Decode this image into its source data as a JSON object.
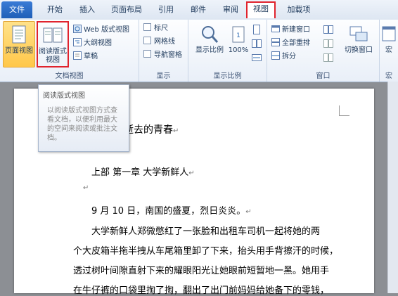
{
  "tabs": [
    "文件",
    "开始",
    "插入",
    "页面布局",
    "引用",
    "邮件",
    "审阅",
    "视图",
    "加载项"
  ],
  "active_tab": "视图",
  "ribbon": {
    "doc_views": {
      "label": "文档视图",
      "page_view": "页面视图",
      "reading_view_1": "阅读版式",
      "reading_view_2": "视图",
      "web_view": "Web 版式视图",
      "outline": "大纲视图",
      "draft": "草稿"
    },
    "show": {
      "label": "显示",
      "ruler": "标尺",
      "gridlines": "网格线",
      "nav_pane": "导航窗格"
    },
    "zoom": {
      "label": "显示比例",
      "zoom": "显示比例",
      "hundred": "100%"
    },
    "window": {
      "label": "窗口",
      "new_window": "新建窗口",
      "arrange_all": "全部重排",
      "split": "拆分",
      "switch_windows": "切换窗口"
    },
    "macros": {
      "label": "宏",
      "macros": "宏"
    }
  },
  "tooltip": {
    "title": "阅读版式视图",
    "lines": [
      "以阅读版式视图方式查",
      "看文档，以便利用最大",
      "的空间来阅读或批注文",
      "档。"
    ]
  },
  "document": {
    "title": "致我们终将逝去的青春",
    "heading": "上部 第一章 大学新鲜人",
    "date_line": "9 月 10 日，南国的盛夏，烈日炎炎。",
    "p1": "大学新鲜人郑微憋红了一张脸和出租车司机一起将她的两",
    "p2": "个大皮箱半拖半拽从车尾箱里卸了下来，抬头用手背擦汗的时候，",
    "p3": "透过树叶间隙直射下来的耀眼阳光让她眼前短暂地一黑。她用手",
    "p4": "在牛仔裤的口袋里掏了掏，翻出了出门前妈妈给她备下的零钱，",
    "para_mark": "↵"
  }
}
